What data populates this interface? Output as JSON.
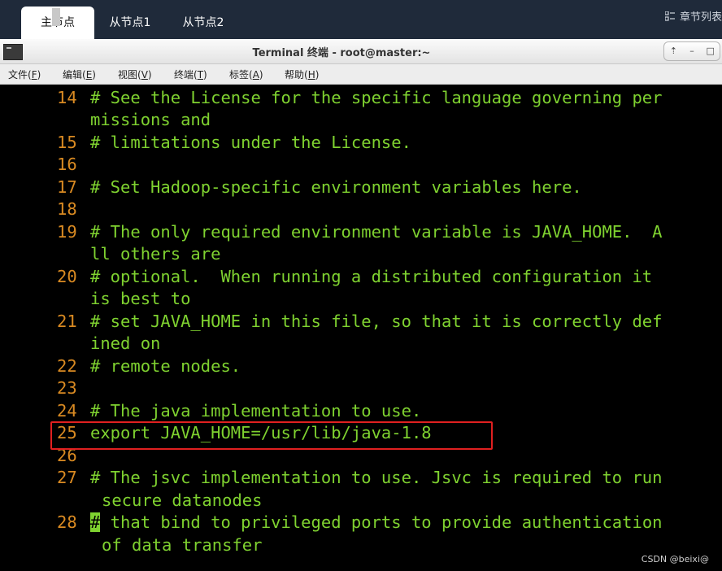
{
  "tabs": [
    {
      "label": "主节点",
      "active": true
    },
    {
      "label": "从节点1",
      "active": false
    },
    {
      "label": "从节点2",
      "active": false
    }
  ],
  "chapter_list_label": "章节列表",
  "window": {
    "title": "Terminal 终端 - root@master:~",
    "buttons": [
      "⇡",
      "–",
      "□"
    ]
  },
  "menu": [
    {
      "label": "文件(",
      "key": "F",
      "end": ")"
    },
    {
      "label": "编辑(",
      "key": "E",
      "end": ")"
    },
    {
      "label": "视图(",
      "key": "V",
      "end": ")"
    },
    {
      "label": "终端(",
      "key": "T",
      "end": ")"
    },
    {
      "label": "标签(",
      "key": "A",
      "end": ")"
    },
    {
      "label": "帮助(",
      "key": "H",
      "end": ")"
    }
  ],
  "lines": [
    {
      "num": "14",
      "text": "# See the License for the specific language governing per"
    },
    {
      "num": "",
      "text": "missions and"
    },
    {
      "num": "15",
      "text": "# limitations under the License."
    },
    {
      "num": "16",
      "text": ""
    },
    {
      "num": "17",
      "text": "# Set Hadoop-specific environment variables here."
    },
    {
      "num": "18",
      "text": ""
    },
    {
      "num": "19",
      "text": "# The only required environment variable is JAVA_HOME.  A"
    },
    {
      "num": "",
      "text": "ll others are"
    },
    {
      "num": "20",
      "text": "# optional.  When running a distributed configuration it"
    },
    {
      "num": "",
      "text": "is best to"
    },
    {
      "num": "21",
      "text": "# set JAVA_HOME in this file, so that it is correctly def"
    },
    {
      "num": "",
      "text": "ined on"
    },
    {
      "num": "22",
      "text": "# remote nodes."
    },
    {
      "num": "23",
      "text": ""
    },
    {
      "num": "24",
      "text": "# The java implementation to use."
    },
    {
      "num": "25",
      "text": "export JAVA_HOME=/usr/lib/java-1.8"
    },
    {
      "num": "26",
      "text": ""
    },
    {
      "num": "27",
      "text": "# The jsvc implementation to use. Jsvc is required to run"
    },
    {
      "num": "",
      "text": "secure datanodes"
    },
    {
      "num": "28",
      "text": " that bind to privileged ports to provide authentication"
    },
    {
      "num": "",
      "text": "of data transfer"
    }
  ],
  "cursor_char": "#",
  "watermark": "CSDN @beixi@"
}
